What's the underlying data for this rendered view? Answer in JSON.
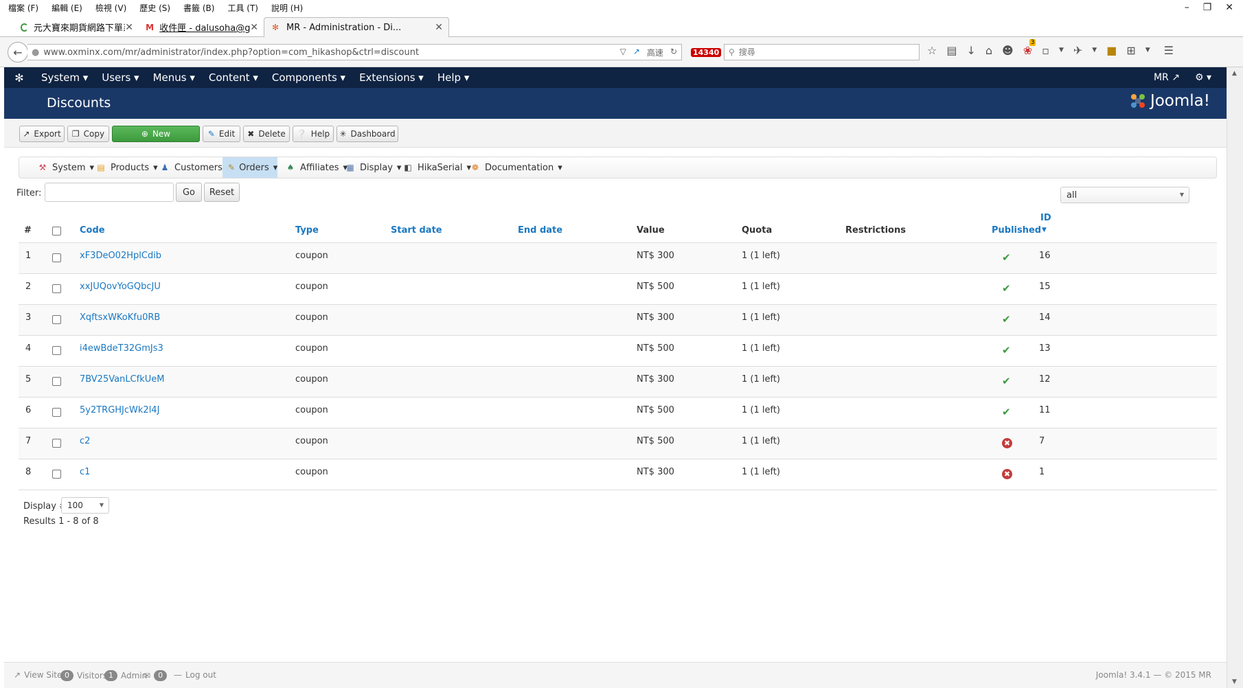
{
  "browser": {
    "menu": [
      "檔案 (F)",
      "編輯 (E)",
      "檢視 (V)",
      "歷史 (S)",
      "書籤 (B)",
      "工具 (T)",
      "說明 (H)"
    ],
    "tabs": [
      {
        "title": "元大寶來期貨網路下單系統"
      },
      {
        "title": "收件匣 - dalusoha@gmail..."
      },
      {
        "title": "MR - Administration - Di..."
      }
    ],
    "url": "www.oxminx.com/mr/administrator/index.php?option=com_hikashop&ctrl=discount",
    "url_speed_label": "高速",
    "counter_badge": "14340",
    "search_placeholder": "搜尋",
    "notification_count": "3"
  },
  "joomla": {
    "topmenu": [
      "System",
      "Users",
      "Menus",
      "Content",
      "Components",
      "Extensions",
      "Help"
    ],
    "user": "MR",
    "page_title": "Discounts",
    "brand": "Joomla!",
    "toolbar": {
      "export": "Export",
      "copy": "Copy",
      "new": "New",
      "edit": "Edit",
      "delete": "Delete",
      "help": "Help",
      "dashboard": "Dashboard"
    },
    "submenu": [
      "System",
      "Products",
      "Customers",
      "Orders",
      "Affiliates",
      "Display",
      "HikaSerial",
      "Documentation"
    ],
    "filter": {
      "label": "Filter:",
      "value": "",
      "go": "Go",
      "reset": "Reset",
      "status_selected": "all"
    },
    "table": {
      "headers": {
        "num": "#",
        "code": "Code",
        "type": "Type",
        "start": "Start date",
        "end": "End date",
        "value": "Value",
        "quota": "Quota",
        "restrictions": "Restrictions",
        "published": "Published",
        "id": "ID"
      },
      "rows": [
        {
          "num": "1",
          "code": "xF3DeO02HplCdib",
          "type": "coupon",
          "start": "",
          "end": "",
          "value": "NT$ 300",
          "quota": "1 (1 left)",
          "restrictions": "",
          "published": true,
          "id": "16"
        },
        {
          "num": "2",
          "code": "xxJUQovYoGQbcJU",
          "type": "coupon",
          "start": "",
          "end": "",
          "value": "NT$ 500",
          "quota": "1 (1 left)",
          "restrictions": "",
          "published": true,
          "id": "15"
        },
        {
          "num": "3",
          "code": "XqftsxWKoKfu0RB",
          "type": "coupon",
          "start": "",
          "end": "",
          "value": "NT$ 300",
          "quota": "1 (1 left)",
          "restrictions": "",
          "published": true,
          "id": "14"
        },
        {
          "num": "4",
          "code": "i4ewBdeT32GmJs3",
          "type": "coupon",
          "start": "",
          "end": "",
          "value": "NT$ 500",
          "quota": "1 (1 left)",
          "restrictions": "",
          "published": true,
          "id": "13"
        },
        {
          "num": "5",
          "code": "7BV25VanLCfkUeM",
          "type": "coupon",
          "start": "",
          "end": "",
          "value": "NT$ 300",
          "quota": "1 (1 left)",
          "restrictions": "",
          "published": true,
          "id": "12"
        },
        {
          "num": "6",
          "code": "5y2TRGHJcWk2l4J",
          "type": "coupon",
          "start": "",
          "end": "",
          "value": "NT$ 500",
          "quota": "1 (1 left)",
          "restrictions": "",
          "published": true,
          "id": "11"
        },
        {
          "num": "7",
          "code": "c2",
          "type": "coupon",
          "start": "",
          "end": "",
          "value": "NT$ 500",
          "quota": "1 (1 left)",
          "restrictions": "",
          "published": false,
          "id": "7"
        },
        {
          "num": "8",
          "code": "c1",
          "type": "coupon",
          "start": "",
          "end": "",
          "value": "NT$ 300",
          "quota": "1 (1 left)",
          "restrictions": "",
          "published": false,
          "id": "1"
        }
      ]
    },
    "pagination": {
      "display_label": "Display #",
      "limit": "100",
      "results": "Results 1 - 8 of 8"
    },
    "status": {
      "view_site": "View Site",
      "visitors_count": "0",
      "visitors": "Visitors",
      "admin_count": "1",
      "admin": "Admin",
      "messages_count": "0",
      "logout": "Log out",
      "copyright": "Joomla! 3.4.1 — © 2015 MR"
    },
    "colors": {
      "nav": "#0f2342",
      "header": "#1a3867",
      "link": "#1a78c2",
      "success": "#3c9a3c",
      "danger": "#c43b3b"
    }
  }
}
